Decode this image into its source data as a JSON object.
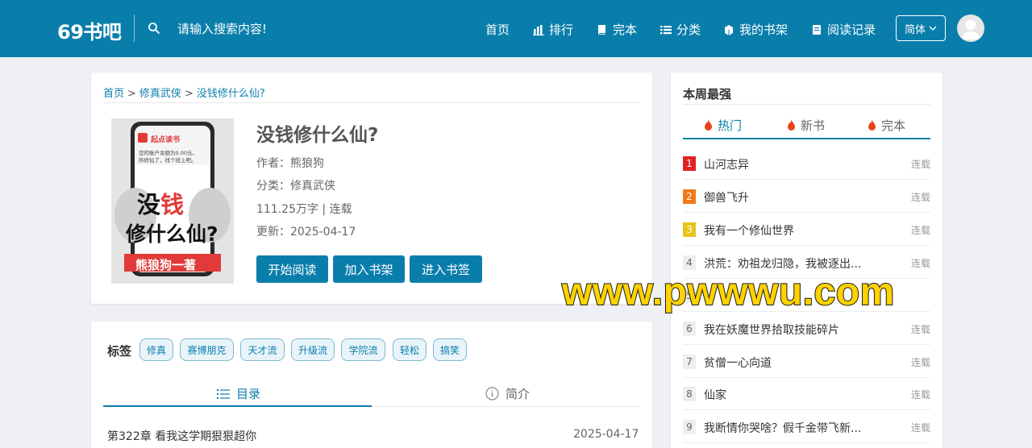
{
  "header": {
    "logo": "69书吧",
    "search_placeholder": "请输入搜索内容!",
    "nav": [
      {
        "label": "首页",
        "icon": "home"
      },
      {
        "label": "排行",
        "icon": "bar-chart-icon"
      },
      {
        "label": "完本",
        "icon": "book-icon"
      },
      {
        "label": "分类",
        "icon": "list-icon"
      },
      {
        "label": "我的书架",
        "icon": "bookshelf-icon"
      },
      {
        "label": "阅读记录",
        "icon": "history-icon"
      }
    ],
    "lang": "简体"
  },
  "breadcrumb": {
    "home": "首页",
    "category": "修真武侠",
    "current": "没钱修什么仙?"
  },
  "book": {
    "title": "没钱修什么仙?",
    "author_label": "作者：",
    "author": "熊狼狗",
    "category_label": "分类：",
    "category": "修真武侠",
    "words_status": "111.25万字 | 连载",
    "updated_label": "更新：",
    "updated": "2025-04-17",
    "cover": {
      "brand": "起点读书",
      "line1": "您的账户余额为0.00元，",
      "line2": "所修仙了，找个班上吧。",
      "big1a": "没",
      "big1b": "钱",
      "big2": "修什么仙?",
      "author": "熊狼狗一著"
    }
  },
  "buttons": {
    "read": "开始阅读",
    "shelf": "加入书架",
    "bookmark": "进入书签"
  },
  "tags": {
    "label": "标签",
    "items": [
      "修真",
      "赛博朋克",
      "天才流",
      "升级流",
      "学院流",
      "轻松",
      "搞笑"
    ]
  },
  "tabs": {
    "catalog": "目录",
    "intro": "简介"
  },
  "latest_chapter": {
    "title": "第322章 看我这学期狠狠超你",
    "date": "2025-04-17"
  },
  "ranking": {
    "title": "本周最强",
    "tabs": [
      "热门",
      "新书",
      "完本"
    ],
    "items": [
      {
        "rank": "1",
        "title": "山河志异",
        "status": "连载"
      },
      {
        "rank": "2",
        "title": "御兽飞升",
        "status": "连载"
      },
      {
        "rank": "3",
        "title": "我有一个修仙世界",
        "status": "连载"
      },
      {
        "rank": "4",
        "title": "洪荒：劝祖龙归隐，我被逐出...",
        "status": "连载"
      },
      {
        "rank": "5",
        "title": "",
        "status": ""
      },
      {
        "rank": "6",
        "title": "我在妖魔世界拾取技能碎片",
        "status": "连载"
      },
      {
        "rank": "7",
        "title": "贫僧一心向道",
        "status": "连载"
      },
      {
        "rank": "8",
        "title": "仙家",
        "status": "连载"
      },
      {
        "rank": "9",
        "title": "我断情你哭啥？假千金带飞新...",
        "status": "连载"
      }
    ],
    "rank_colors": {
      "1": "#e02222",
      "2": "#f07a1a",
      "3": "#e6c41a"
    }
  },
  "watermark": "www.pwwwu.com",
  "colors": {
    "brand": "#0a7eab",
    "tag_border": "#7fb9d0",
    "hot_icon": "#e8441a"
  }
}
